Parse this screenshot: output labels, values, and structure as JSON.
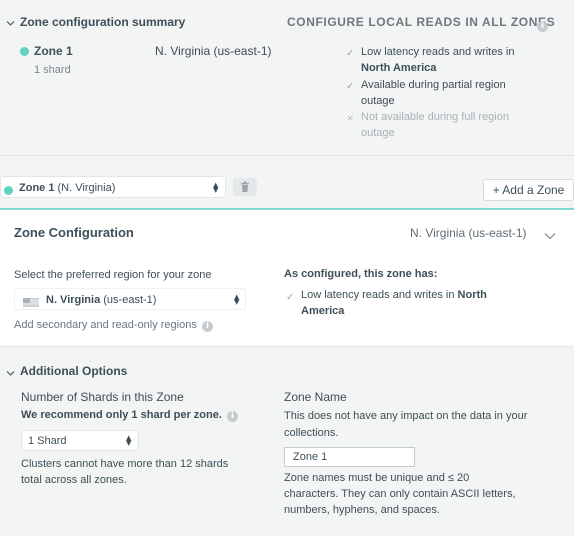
{
  "summary": {
    "title": "Zone configuration summary",
    "configure_button": "CONFIGURE LOCAL READS IN ALL ZONES",
    "zone_name": "Zone 1",
    "zone_shards": "1 shard",
    "zone_region": "N. Virginia (us-east-1)",
    "benefits": [
      {
        "mark": "✓",
        "text": "Low latency reads and writes in",
        "bold": "North America"
      },
      {
        "mark": "✓",
        "text": "Available during partial region",
        "text2": "outage"
      },
      {
        "mark": "×",
        "text": "Not available during full region",
        "text2": "outage"
      }
    ]
  },
  "tabs": {
    "zone_bold": "Zone 1",
    "zone_suffix": "(N. Virginia)",
    "add_zone": "+ Add a Zone"
  },
  "zone_config": {
    "title": "Zone Configuration",
    "region_header": "N. Virginia (us-east-1)",
    "select_label": "Select the preferred region for your zone",
    "selected_region_bold": "N. Virginia",
    "selected_region_rest": "(us-east-1)",
    "secondary_link": "Add secondary and read-only regions",
    "configured_title": "As configured, this zone has:",
    "configured_line1": "Low latency reads and writes in",
    "configured_bold1": "North",
    "configured_bold2": "America"
  },
  "additional": {
    "title": "Additional Options",
    "shards_label": "Number of Shards in this Zone",
    "shards_recommend": "We recommend only 1 shard per zone.",
    "shards_value": "1 Shard",
    "shards_note1": "Clusters cannot have more than 12 shards",
    "shards_note2": "total across all zones.",
    "zone_name_label": "Zone Name",
    "zone_name_desc1": "This does not have any impact on the data in your",
    "zone_name_desc2": "collections.",
    "zone_name_value": "Zone 1",
    "zone_name_rules1": "Zone names must be unique and ≤ 20",
    "zone_name_rules2": "characters. They can only contain ASCII letters,",
    "zone_name_rules3": "numbers, hyphens, and spaces."
  }
}
